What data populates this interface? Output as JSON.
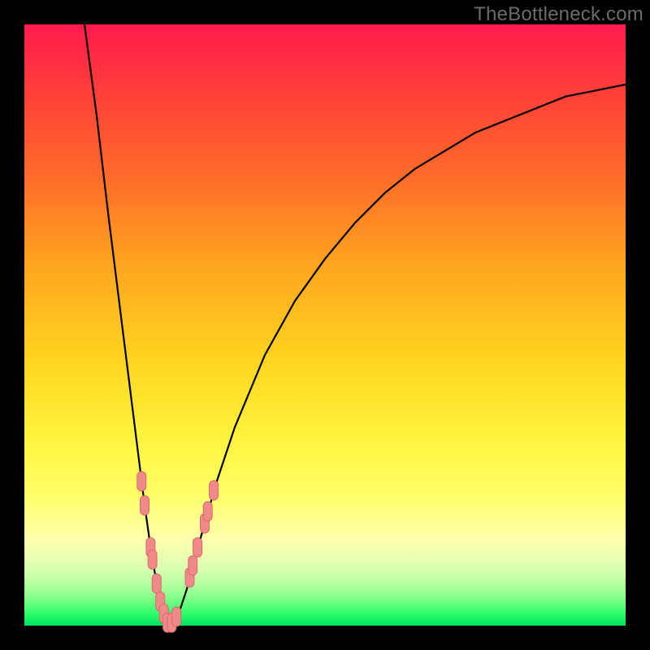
{
  "watermark": "TheBottleneck.com",
  "colors": {
    "curve": "#000000",
    "marker_fill": "#f08a8a",
    "marker_stroke": "#d66b6b"
  },
  "chart_data": {
    "type": "line",
    "title": "",
    "xlabel": "",
    "ylabel": "",
    "xlim": [
      0,
      100
    ],
    "ylim": [
      0,
      100
    ],
    "grid": false,
    "legend": false,
    "series": [
      {
        "name": "bottleneck-curve",
        "comment": "V-shaped bottleneck curve; y is bottleneck percent, minimum near x=24",
        "points": [
          {
            "x": 10,
            "y": 100
          },
          {
            "x": 12,
            "y": 85
          },
          {
            "x": 14,
            "y": 68
          },
          {
            "x": 16,
            "y": 52
          },
          {
            "x": 18,
            "y": 36
          },
          {
            "x": 19,
            "y": 28
          },
          {
            "x": 20,
            "y": 20
          },
          {
            "x": 21,
            "y": 13
          },
          {
            "x": 22,
            "y": 7
          },
          {
            "x": 23,
            "y": 3
          },
          {
            "x": 24,
            "y": 0
          },
          {
            "x": 25,
            "y": 1
          },
          {
            "x": 26,
            "y": 3
          },
          {
            "x": 27,
            "y": 6
          },
          {
            "x": 28,
            "y": 10
          },
          {
            "x": 30,
            "y": 17
          },
          {
            "x": 32,
            "y": 24
          },
          {
            "x": 35,
            "y": 33
          },
          {
            "x": 40,
            "y": 45
          },
          {
            "x": 45,
            "y": 54
          },
          {
            "x": 50,
            "y": 61
          },
          {
            "x": 55,
            "y": 67
          },
          {
            "x": 60,
            "y": 72
          },
          {
            "x": 65,
            "y": 76
          },
          {
            "x": 70,
            "y": 79
          },
          {
            "x": 75,
            "y": 82
          },
          {
            "x": 80,
            "y": 84
          },
          {
            "x": 85,
            "y": 86
          },
          {
            "x": 90,
            "y": 88
          },
          {
            "x": 95,
            "y": 89
          },
          {
            "x": 100,
            "y": 90
          }
        ]
      }
    ],
    "markers": {
      "name": "highlighted-points",
      "comment": "Salmon pill markers clustered near the trough of the V",
      "points": [
        {
          "x": 19.5,
          "y": 24
        },
        {
          "x": 20.0,
          "y": 20
        },
        {
          "x": 21.0,
          "y": 13
        },
        {
          "x": 21.3,
          "y": 11
        },
        {
          "x": 22.0,
          "y": 7
        },
        {
          "x": 22.6,
          "y": 4
        },
        {
          "x": 23.2,
          "y": 2
        },
        {
          "x": 23.8,
          "y": 0.5
        },
        {
          "x": 24.5,
          "y": 0.5
        },
        {
          "x": 25.3,
          "y": 1.5
        },
        {
          "x": 27.5,
          "y": 8
        },
        {
          "x": 28.0,
          "y": 10
        },
        {
          "x": 28.8,
          "y": 13
        },
        {
          "x": 30.0,
          "y": 17
        },
        {
          "x": 30.5,
          "y": 19
        },
        {
          "x": 31.5,
          "y": 22.5
        }
      ]
    }
  }
}
